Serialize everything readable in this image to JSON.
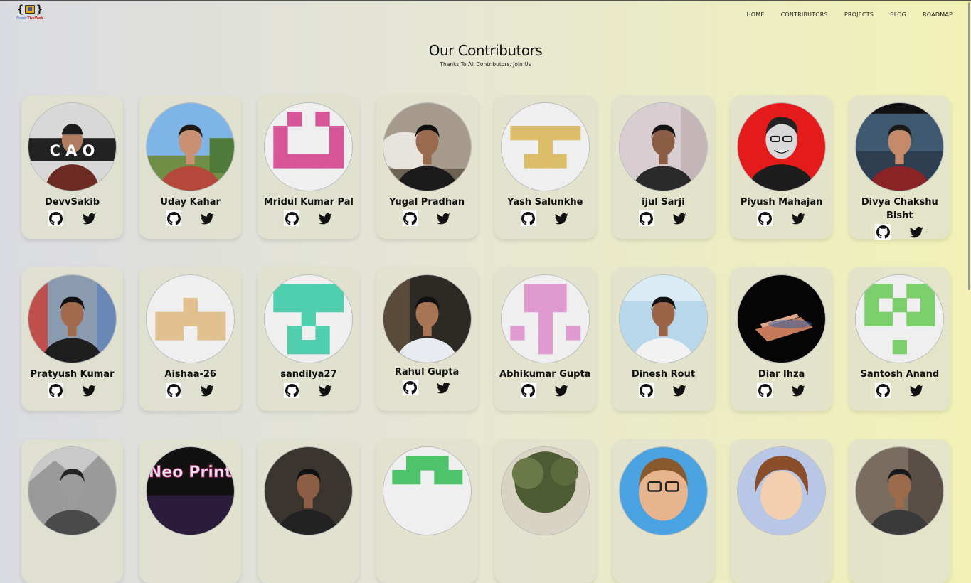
{
  "brand": {
    "name_part1": "Power",
    "name_part2": "TheWeb"
  },
  "nav": [
    "HOME",
    "CONTRIBUTORS",
    "PROJECTS",
    "BLOG",
    "ROADMAP"
  ],
  "hero": {
    "title": "Our Contributors",
    "subtitle": "Thanks To All Contributors. Join Us"
  },
  "colors": {
    "accent_brand": "#e8a512",
    "card_bg": "#e1e1cd"
  },
  "contributors": [
    {
      "name": "DevvSakib",
      "avatar": "photo-text-ciao"
    },
    {
      "name": "Uday Kahar",
      "avatar": "photo-sky"
    },
    {
      "name": "Mridul Kumar Pal",
      "avatar": "identicon-pink"
    },
    {
      "name": "Yugal Pradhan",
      "avatar": "photo-rocks"
    },
    {
      "name": "Yash Salunkhe",
      "avatar": "identicon-gold"
    },
    {
      "name": "ijul Sarji",
      "avatar": "photo-light"
    },
    {
      "name": "Piyush Mahajan",
      "avatar": "photo-red"
    },
    {
      "name": "Divya Chakshu Bisht",
      "avatar": "photo-river"
    },
    {
      "name": "Pratyush Kumar",
      "avatar": "photo-mall"
    },
    {
      "name": "Aishaa-26",
      "avatar": "identicon-tan"
    },
    {
      "name": "sandilya27",
      "avatar": "identicon-teal"
    },
    {
      "name": "Rahul Gupta",
      "avatar": "photo-street"
    },
    {
      "name": "Abhikumar Gupta",
      "avatar": "identicon-pinklight"
    },
    {
      "name": "Dinesh Rout",
      "avatar": "photo-blue"
    },
    {
      "name": "Diar Ihza",
      "avatar": "photo-laptop"
    },
    {
      "name": "Santosh Anand",
      "avatar": "identicon-green"
    },
    {
      "name": "",
      "avatar": "photo-gray"
    },
    {
      "name": "",
      "avatar": "photo-neoprint"
    },
    {
      "name": "",
      "avatar": "photo-dark"
    },
    {
      "name": "",
      "avatar": "identicon-green2"
    },
    {
      "name": "",
      "avatar": "photo-tree"
    },
    {
      "name": "",
      "avatar": "cartoon-blue"
    },
    {
      "name": "",
      "avatar": "cartoon-anime"
    },
    {
      "name": "",
      "avatar": "photo-sunglasses"
    }
  ],
  "avatar_text": {
    "ciao": "C  A O",
    "neo": "Neo Print"
  },
  "icons": {
    "github": "github-icon",
    "twitter": "twitter-icon"
  }
}
